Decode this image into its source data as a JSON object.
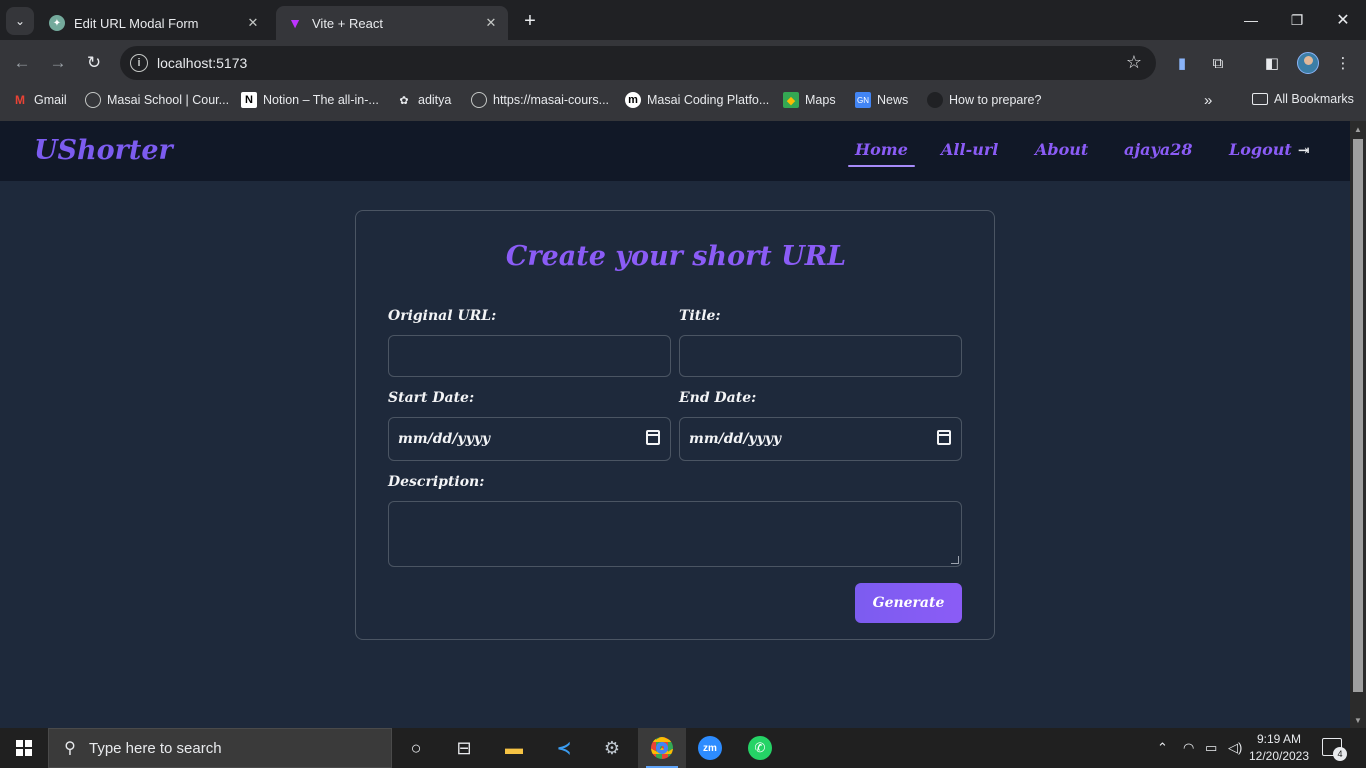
{
  "browser": {
    "tabs": [
      {
        "title": "Edit URL Modal Form",
        "active": false
      },
      {
        "title": "Vite + React",
        "active": true
      }
    ],
    "address": "localhost:5173",
    "bookmarks": [
      {
        "label": "Gmail",
        "icon": "gmail-icon"
      },
      {
        "label": "Masai School | Cour...",
        "icon": "globe-icon"
      },
      {
        "label": "Notion – The all-in-...",
        "icon": "notion-icon"
      },
      {
        "label": "aditya",
        "icon": "github-icon"
      },
      {
        "label": "https://masai-cours...",
        "icon": "globe-icon"
      },
      {
        "label": "Masai Coding Platfo...",
        "icon": "masai-icon"
      },
      {
        "label": "Maps",
        "icon": "maps-icon"
      },
      {
        "label": "News",
        "icon": "news-icon"
      },
      {
        "label": "How to prepare?",
        "icon": "page-icon"
      }
    ],
    "all_bookmarks_label": "All Bookmarks"
  },
  "app": {
    "brand": "UShorter",
    "nav": {
      "home": "Home",
      "all_url": "All-url",
      "about": "About",
      "user": "ajaya28",
      "logout": "Logout"
    },
    "form": {
      "title": "Create your short URL",
      "original_url_label": "Original URL:",
      "title_label": "Title:",
      "start_date_label": "Start Date:",
      "end_date_label": "End Date:",
      "date_placeholder": "mm/dd/yyyy",
      "description_label": "Description:",
      "generate_label": "Generate"
    },
    "colors": {
      "accent": "#8b5cf6",
      "navbar_bg": "#111827",
      "page_bg": "#1e293b"
    }
  },
  "taskbar": {
    "search_placeholder": "Type here to search",
    "time": "9:19 AM",
    "date": "12/20/2023",
    "notification_count": "4"
  }
}
